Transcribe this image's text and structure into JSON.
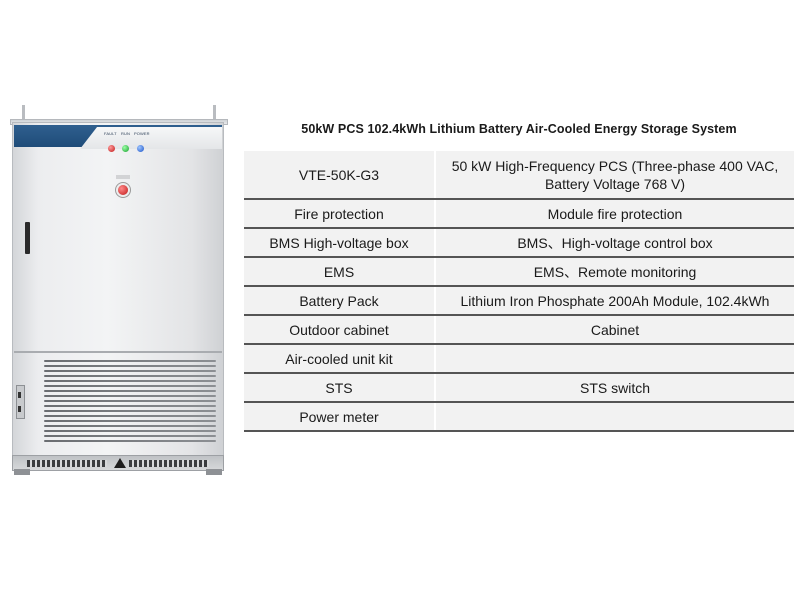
{
  "product": {
    "title": "50kW PCS 102.4kWh Lithium Battery Air-Cooled Energy Storage System",
    "image_alt": "Air-cooled energy storage cabinet"
  },
  "cabinet_panel": {
    "indicator_labels": [
      "FAULT",
      "RUN",
      "POWER"
    ],
    "indicator_colors": {
      "fault": "#c01818",
      "run": "#16a02b",
      "power": "#1a52c7"
    },
    "accent_color": "#2f5f8f"
  },
  "spec_rows": [
    {
      "item": "VTE-50K-G3",
      "value": "50 kW High-Frequency PCS (Three-phase 400 VAC, Battery Voltage 768 V)"
    },
    {
      "item": "Fire protection",
      "value": "Module fire protection"
    },
    {
      "item": "BMS High-voltage box",
      "value": "BMS、High-voltage control box"
    },
    {
      "item": "EMS",
      "value": "EMS、Remote monitoring"
    },
    {
      "item": "Battery Pack",
      "value": "Lithium Iron Phosphate 200Ah Module, 102.4kWh"
    },
    {
      "item": "Outdoor cabinet",
      "value": "Cabinet"
    },
    {
      "item": "Air-cooled unit kit",
      "value": ""
    },
    {
      "item": "STS",
      "value": "STS switch"
    },
    {
      "item": "Power meter",
      "value": ""
    }
  ]
}
